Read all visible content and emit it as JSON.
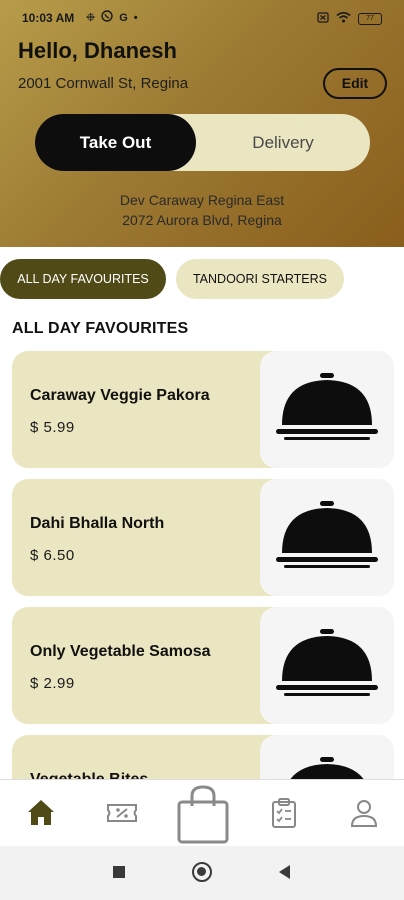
{
  "status_bar": {
    "time": "10:03 AM",
    "left_icons": [
      "settings-icon",
      "whatsapp-icon",
      "google-icon",
      "dot-icon"
    ],
    "right_icons": [
      "sim-icon",
      "wifi-icon",
      "battery-icon"
    ],
    "battery_level": "77"
  },
  "header": {
    "greeting": "Hello, Dhanesh",
    "address": "2001 Cornwall St, Regina",
    "edit_label": "Edit"
  },
  "order_mode": {
    "options": [
      "Take Out",
      "Delivery"
    ],
    "selected": "Take Out"
  },
  "store": {
    "name": "Dev Caraway Regina East",
    "address": "2072 Aurora Blvd, Regina"
  },
  "categories": [
    {
      "label": "ALL DAY FAVOURITES",
      "active": true
    },
    {
      "label": "TANDOORI STARTERS",
      "active": false
    }
  ],
  "section_title": "ALL DAY FAVOURITES",
  "menu_items": [
    {
      "name": "Caraway Veggie Pakora",
      "price": "$  5.99",
      "image": "cloche-icon"
    },
    {
      "name": "Dahi Bhalla North",
      "price": "$  6.50",
      "image": "cloche-icon"
    },
    {
      "name": "Only Vegetable Samosa",
      "price": "$  2.99",
      "image": "cloche-icon"
    },
    {
      "name": "Vegetable Bites",
      "price": "",
      "image": "cloche-icon"
    }
  ],
  "bottom_nav": {
    "items": [
      "home-icon",
      "coupon-icon",
      "cart-icon",
      "orders-icon",
      "profile-icon"
    ],
    "active": "home-icon"
  },
  "colors": {
    "header_gradient_start": "#b79d4a",
    "header_gradient_end": "#8a5e1c",
    "accent_dark_olive": "#4f4a16",
    "card_bg": "#ebe6c2",
    "toggle_active": "#0d0d0d"
  }
}
